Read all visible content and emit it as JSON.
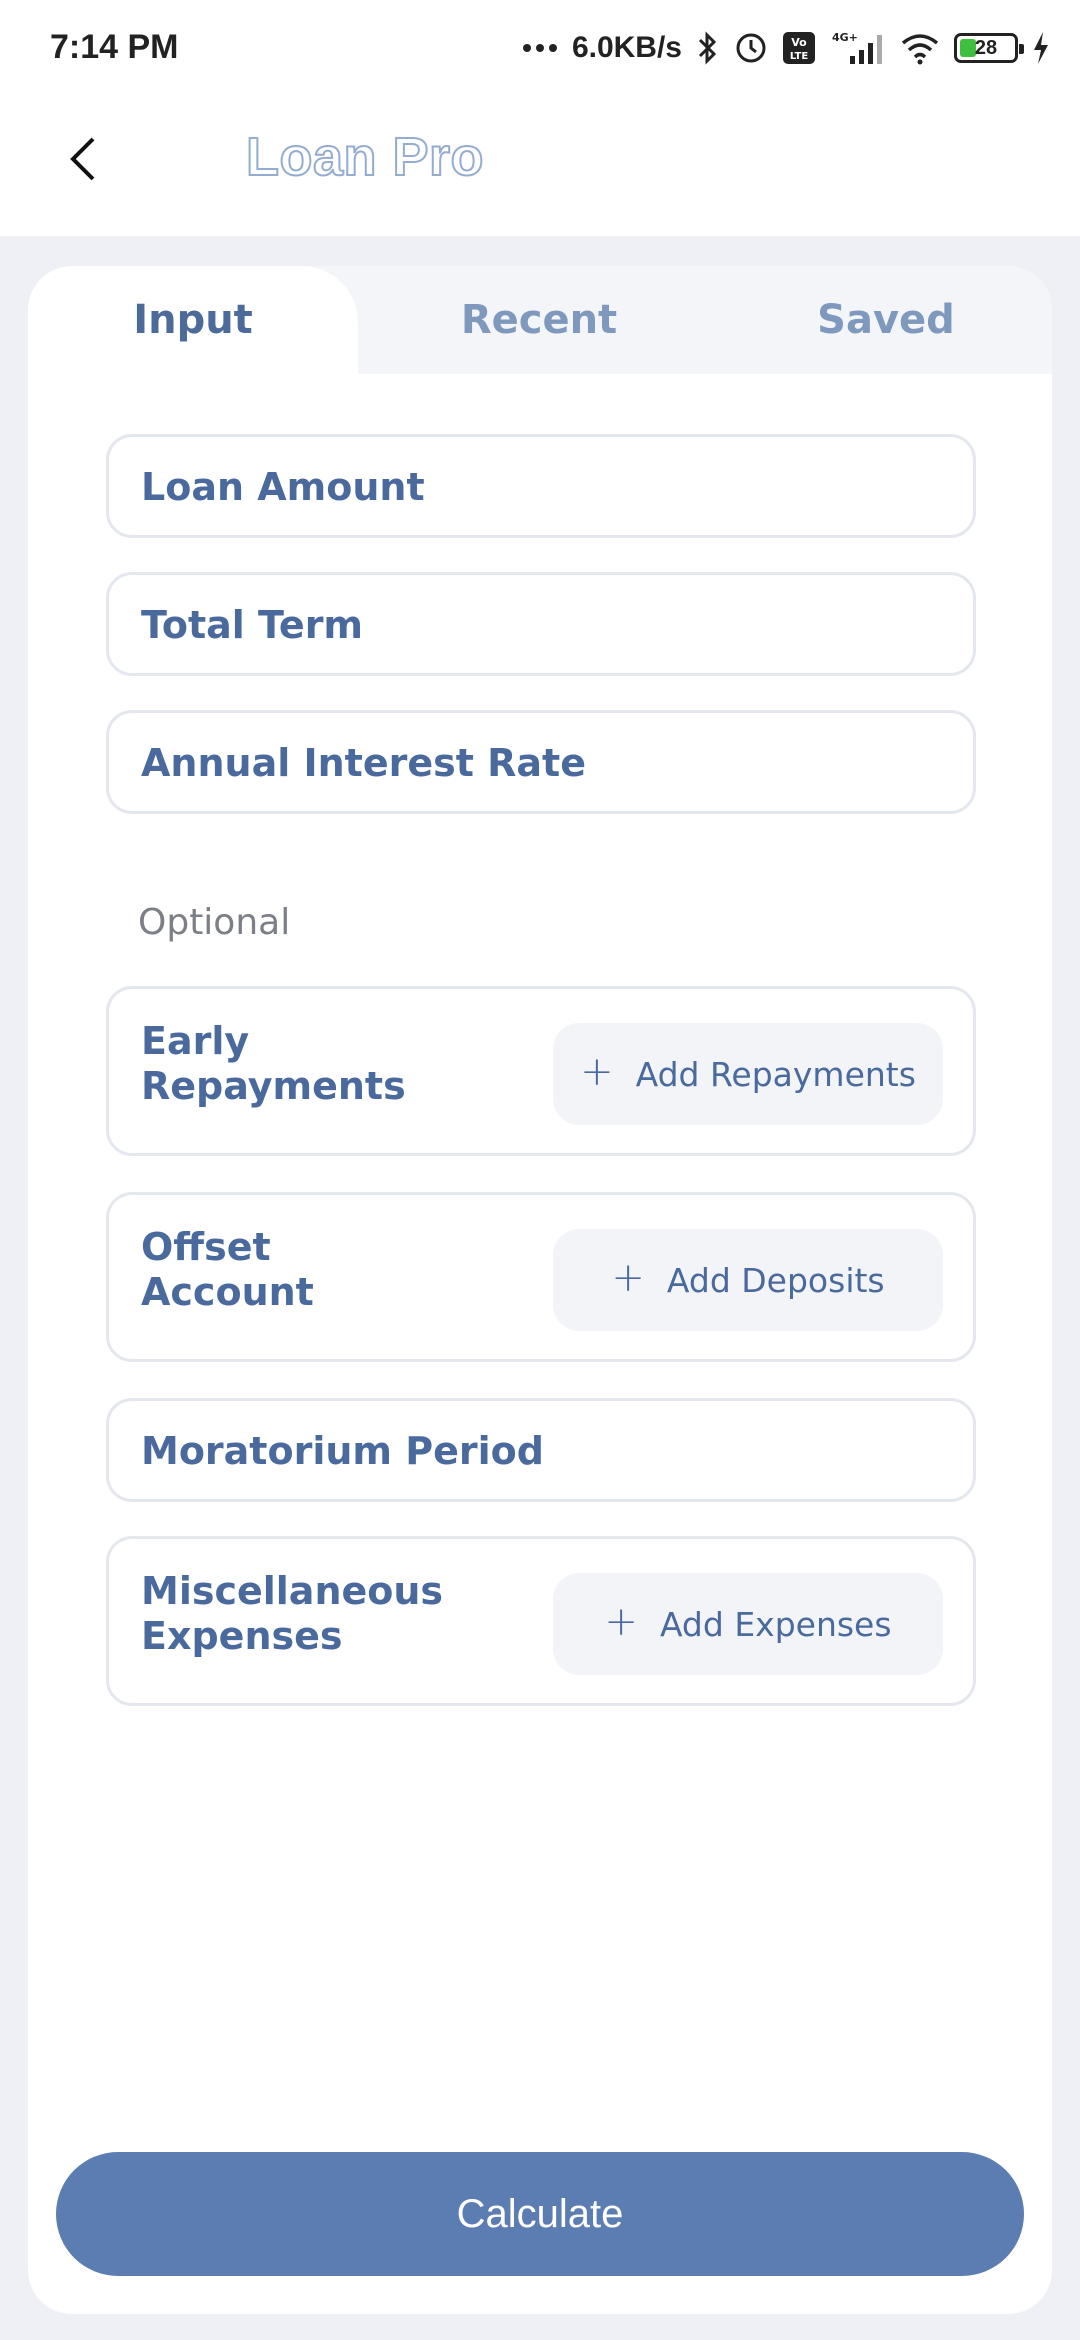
{
  "status_bar": {
    "time": "7:14 PM",
    "net_speed": "6.0KB/s",
    "volte": "Vo LTE",
    "network": "4G+",
    "battery": "28",
    "icons": [
      "dots-icon",
      "bluetooth-icon",
      "alarm-icon",
      "volte-icon",
      "signal-icon",
      "wifi-icon",
      "battery-icon",
      "charging-icon"
    ]
  },
  "app_bar": {
    "title": "Loan Pro",
    "back_icon": "chevron-left-icon"
  },
  "tabs": [
    {
      "label": "Input",
      "active": true
    },
    {
      "label": "Recent",
      "active": false
    },
    {
      "label": "Saved",
      "active": false
    }
  ],
  "fields": {
    "loan_amount": "Loan Amount",
    "total_term": "Total Term",
    "annual_interest_rate": "Annual Interest Rate",
    "moratorium_period": "Moratorium Period"
  },
  "optional": {
    "heading": "Optional",
    "early_repayments": {
      "label_line1": "Early",
      "label_line2": "Repayments",
      "button": "Add Repayments"
    },
    "offset_account": {
      "label_line1": "Offset",
      "label_line2": "Account",
      "button": "Add Deposits"
    },
    "misc_expenses": {
      "label_line1": "Miscellaneous",
      "label_line2": "Expenses",
      "button": "Add Expenses"
    }
  },
  "calculate_label": "Calculate",
  "colors": {
    "primary": "#5c7db1",
    "label": "#4a6a9d",
    "background": "#eef0f5"
  }
}
